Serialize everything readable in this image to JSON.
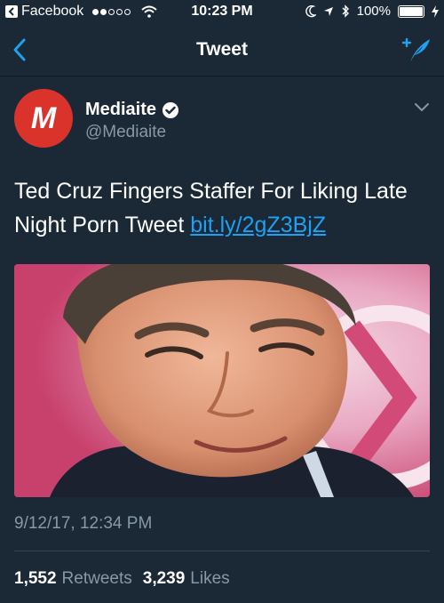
{
  "status_bar": {
    "back_app_label": "Facebook",
    "time": "10:23 PM",
    "battery_percent": "100%"
  },
  "nav": {
    "title": "Tweet"
  },
  "tweet": {
    "author_name": "Mediaite",
    "author_handle": "@Mediaite",
    "avatar_letter": "M",
    "text": "Ted Cruz Fingers Staffer For Liking Late Night Porn Tweet ",
    "link_text": "bit.ly/2gZ3BjZ",
    "timestamp": "9/12/17, 12:34 PM",
    "retweets_count": "1,552",
    "retweets_label": "Retweets",
    "likes_count": "3,239",
    "likes_label": "Likes"
  },
  "colors": {
    "background": "#1b2836",
    "accent": "#1da1f2",
    "muted_text": "#8899a6",
    "avatar_bg": "#d9332c"
  }
}
